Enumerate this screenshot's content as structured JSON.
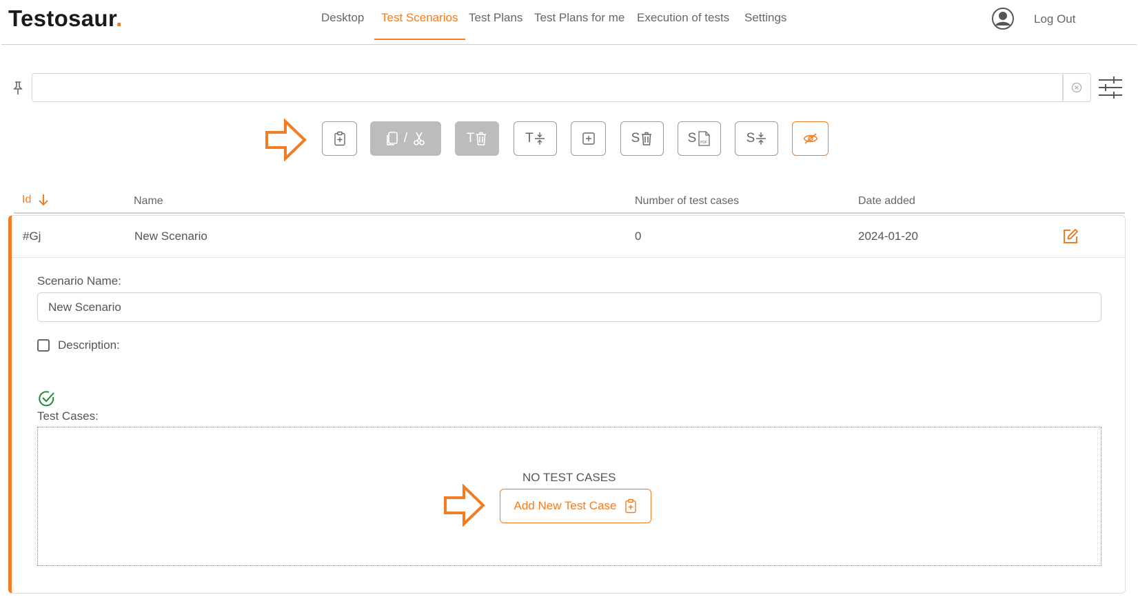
{
  "app": {
    "logo_text": "Testosaur",
    "logo_dot": ".",
    "accent_color": "#f47c20"
  },
  "nav": {
    "items": [
      {
        "label": "Desktop",
        "active": false
      },
      {
        "label": "Test Scenarios",
        "active": true
      },
      {
        "label": "Test Plans",
        "active": false
      },
      {
        "label": "Test Plans for me",
        "active": false
      },
      {
        "label": "Execution of tests",
        "active": false
      },
      {
        "label": "Settings",
        "active": false
      }
    ],
    "logout_label": "Log Out"
  },
  "search": {
    "value": "",
    "placeholder": ""
  },
  "toolbar": {
    "buttons": [
      {
        "icon": "clipboard-plus-icon",
        "text": "",
        "disabled": false
      },
      {
        "icon": "copy-cut-icon",
        "text": "/",
        "disabled": true
      },
      {
        "icon": "delete-test-case-icon",
        "text": "T",
        "disabled": true
      },
      {
        "icon": "expand-test-cases-icon",
        "text": "T",
        "disabled": false
      },
      {
        "icon": "add-box-icon",
        "text": "",
        "disabled": false
      },
      {
        "icon": "delete-scenario-icon",
        "text": "S",
        "disabled": false
      },
      {
        "icon": "scenario-pdf-icon",
        "text": "S",
        "disabled": false
      },
      {
        "icon": "expand-scenarios-icon",
        "text": "S",
        "disabled": false
      },
      {
        "icon": "hide-eye-icon",
        "text": "",
        "disabled": false
      }
    ]
  },
  "table": {
    "headers": {
      "id": "Id",
      "name": "Name",
      "count": "Number of test cases",
      "date": "Date added"
    },
    "rows": [
      {
        "id": "#Gj",
        "name": "New Scenario",
        "count": "0",
        "date": "2024-01-20"
      }
    ]
  },
  "detail": {
    "scenario_name_label": "Scenario Name:",
    "scenario_name_value": "New Scenario",
    "description_label": "Description:",
    "description_checked": false,
    "test_cases_label": "Test Cases:",
    "no_test_cases": "NO TEST CASES",
    "add_button_label": "Add New Test Case"
  }
}
